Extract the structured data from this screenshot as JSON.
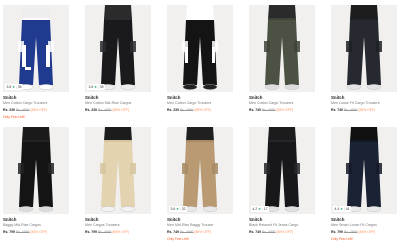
{
  "products": [
    {
      "brand": "Snitch",
      "title": "Men Cotton Cargo Trousers",
      "price": "Rs. 239",
      "mrp": "Rs. 4999",
      "off": "(65% OFF)",
      "stock": "Only Few Left!",
      "rating": "3.8",
      "count": "35",
      "pants_color": "#1f3a8f",
      "accent": "#ffffff",
      "shirt": "#eeeeee",
      "shoe": "#ffffff"
    },
    {
      "brand": "Snitch",
      "title": "Men Cotton Mid-Rise Cargos",
      "price": "Rs. 239",
      "mrp": "Rs. 4999",
      "off": "(65% OFF)",
      "stock": "",
      "rating": "3.6",
      "count": "39",
      "pants_color": "#1a1a1d",
      "accent": "#2c2c30",
      "shirt": "#2b2b2b",
      "shoe": "#eeeeee"
    },
    {
      "brand": "Snitch",
      "title": "Men Cotton Cargo Trousers",
      "price": "Rs. 239",
      "mrp": "Rs. 4999",
      "off": "(65% OFF)",
      "stock": "",
      "rating": "",
      "count": "",
      "pants_color": "#141414",
      "accent": "#ffffff",
      "shirt": "#ffffff",
      "shoe": "#222222"
    },
    {
      "brand": "Snitch",
      "title": "Men Cotton Cargo Trousers",
      "price": "Rs. 749",
      "mrp": "Rs. 4999",
      "off": "(85% OFF)",
      "stock": "",
      "rating": "",
      "count": "",
      "pants_color": "#4b5244",
      "accent": "#3e4538",
      "shirt": "#2b2b2b",
      "shoe": "#dddddd"
    },
    {
      "brand": "Snitch",
      "title": "Men Loose Fit Cargo Trousers",
      "price": "Rs. 749",
      "mrp": "Rs. 4999",
      "off": "(85% OFF)",
      "stock": "",
      "rating": "",
      "count": "",
      "pants_color": "#262a30",
      "accent": "#1d2025",
      "shirt": "#1d1d1d",
      "shoe": "#e5e5e5"
    },
    {
      "brand": "Snitch",
      "title": "Baggy Mid-Rise Cargos",
      "price": "Rs. 799",
      "mrp": "Rs. 4999",
      "off": "(84% OFF)",
      "stock": "",
      "rating": "",
      "count": "",
      "pants_color": "#141414",
      "accent": "#222222",
      "shirt": "#1a1a1a",
      "shoe": "#dddddd"
    },
    {
      "brand": "Snitch",
      "title": "Men Cargos Trousers",
      "price": "Rs. 799",
      "mrp": "Rs. 4999",
      "off": "(84% OFF)",
      "stock": "",
      "rating": "",
      "count": "",
      "pants_color": "#e3d3b1",
      "accent": "#d6c49f",
      "shirt": "#1c1c1c",
      "shoe": "#f2f2f2"
    },
    {
      "brand": "Snitch",
      "title": "Men Mid-Rise Baggy Trouser",
      "price": "Rs. 749",
      "mrp": "Rs. 4999",
      "off": "(85% OFF)",
      "stock": "Only Few Left!",
      "rating": "3.6",
      "count": "32",
      "pants_color": "#b99a72",
      "accent": "#a78963",
      "shirt": "#202020",
      "shoe": "#e8e8e8"
    },
    {
      "brand": "Snitch",
      "title": "Black Relaxed Fit Jeans Cargo",
      "price": "Rs. 749",
      "mrp": "Rs. 4999",
      "off": "(85% OFF)",
      "stock": "",
      "rating": "4.2",
      "count": "17",
      "pants_color": "#18181b",
      "accent": "#26262a",
      "shirt": "#1c1c1c",
      "shoe": "#e0e0e0"
    },
    {
      "brand": "Snitch",
      "title": "Men Smart Loose Fit Cargos",
      "price": "Rs. 799",
      "mrp": "Rs. 4999",
      "off": "(84% OFF)",
      "stock": "Only Few Left!",
      "rating": "4.4",
      "count": "41",
      "pants_color": "#1b2233",
      "accent": "#141a28",
      "shirt": "#111111",
      "shoe": "#e8e8e8"
    }
  ]
}
